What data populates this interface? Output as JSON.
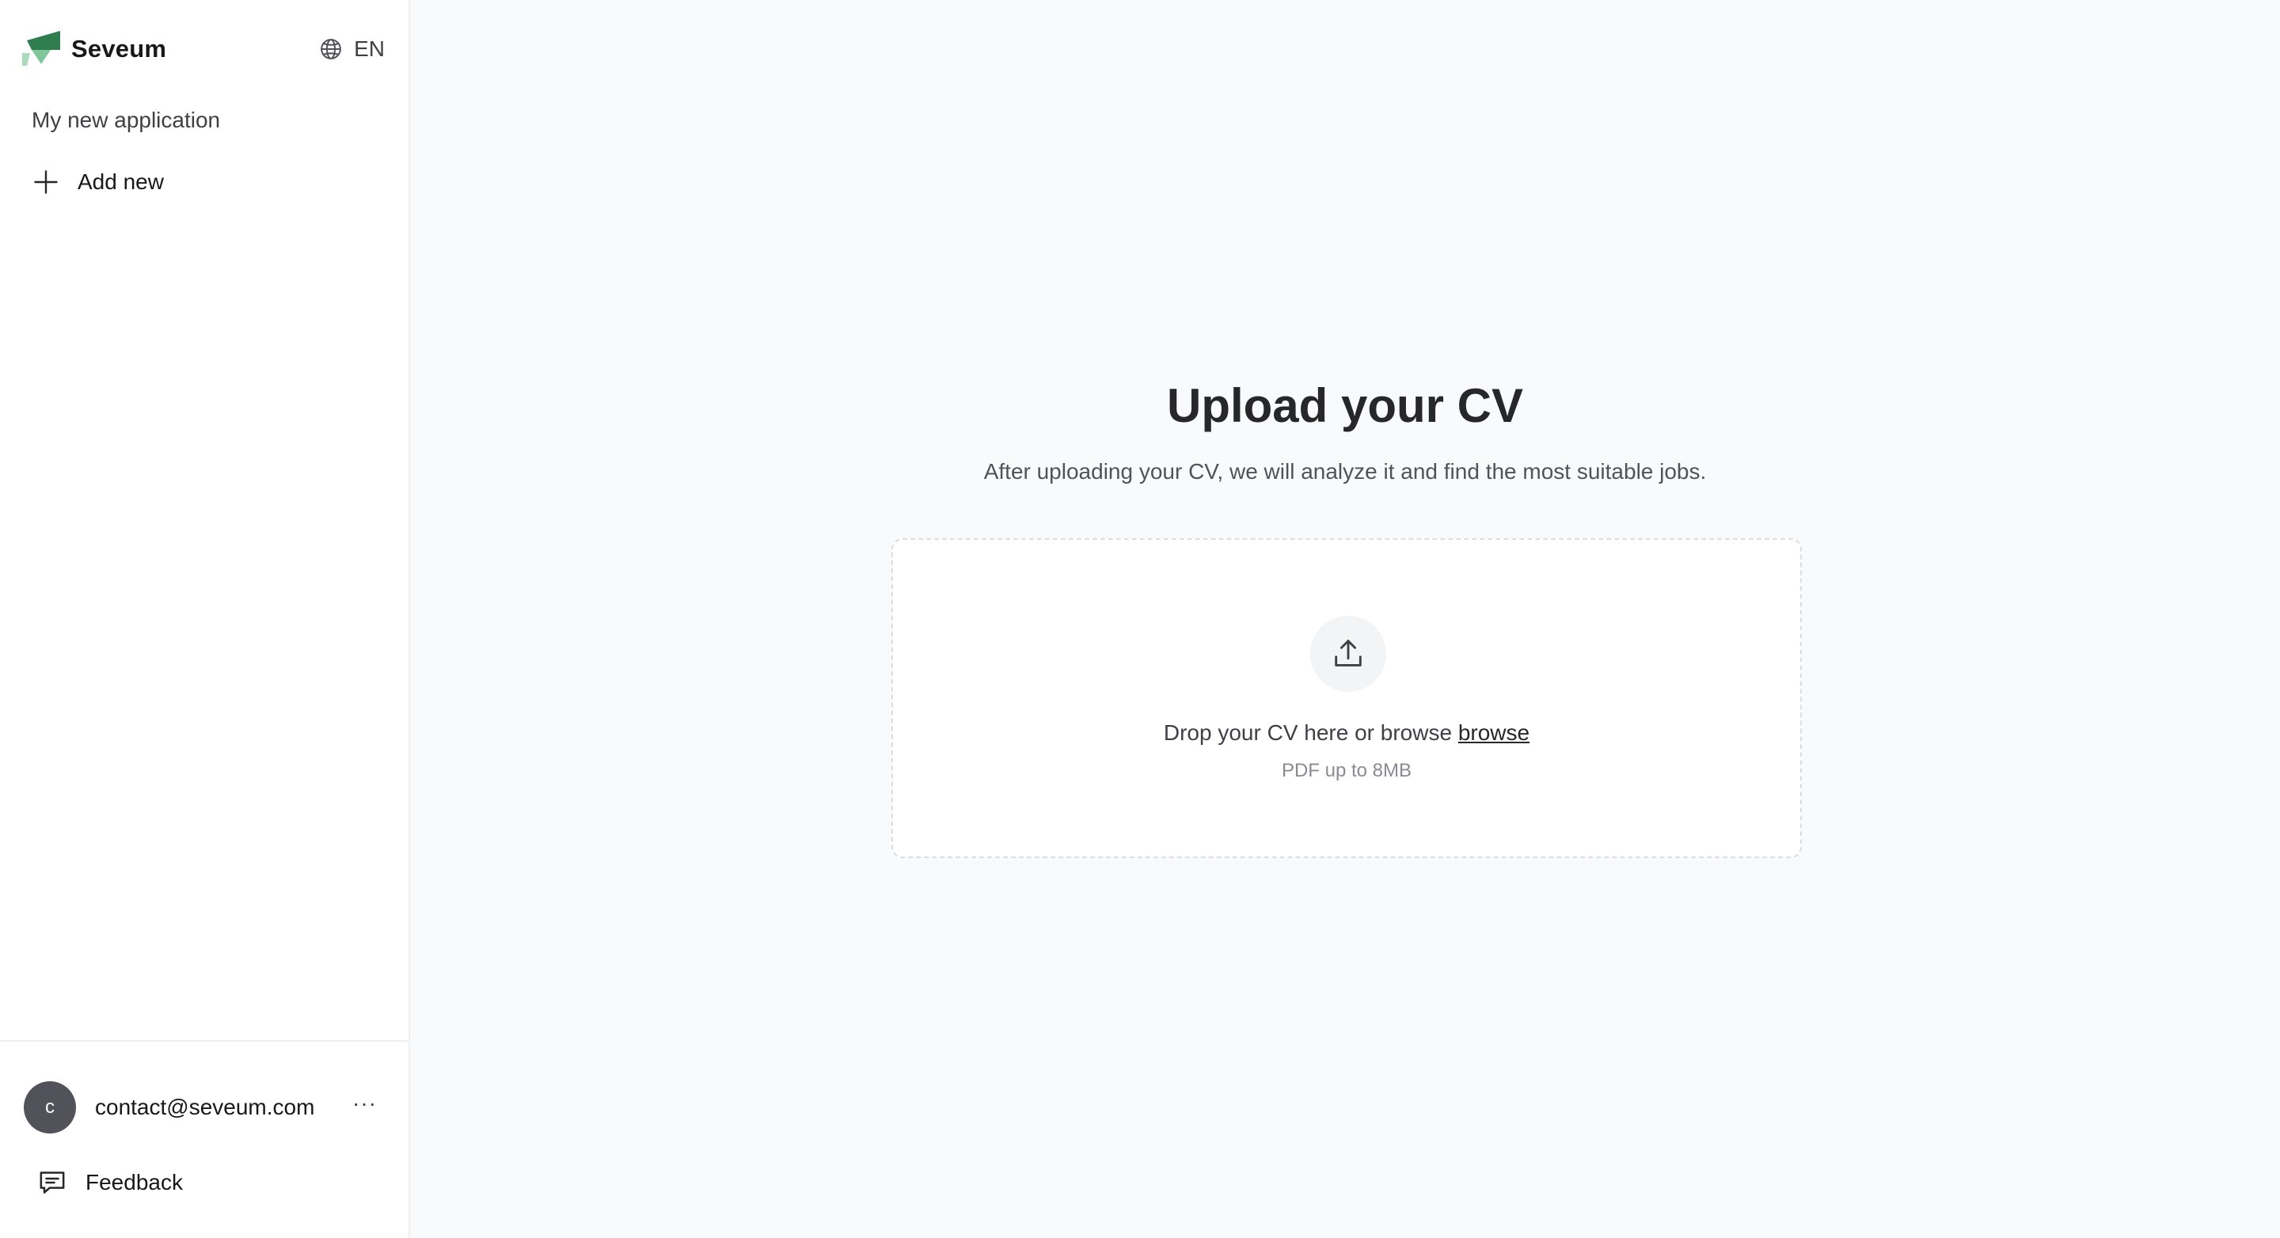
{
  "brand": {
    "name": "Seveum",
    "accent": "#2f7d4f"
  },
  "language": {
    "code": "EN",
    "icon": "globe-icon"
  },
  "sidebar": {
    "current_application": "My new application",
    "add_new_label": "Add new"
  },
  "account": {
    "avatar_initial": "c",
    "email": "contact@seveum.com",
    "more_label": "···"
  },
  "feedback": {
    "label": "Feedback",
    "icon": "message-square-icon"
  },
  "main": {
    "title": "Upload your CV",
    "subtitle": "After uploading your CV, we will analyze it and find the most suitable jobs.",
    "dropzone": {
      "prompt": "Drop your CV here or browse",
      "browse_label": "browse",
      "hint": "PDF up to 8MB",
      "icon": "upload-icon"
    }
  }
}
